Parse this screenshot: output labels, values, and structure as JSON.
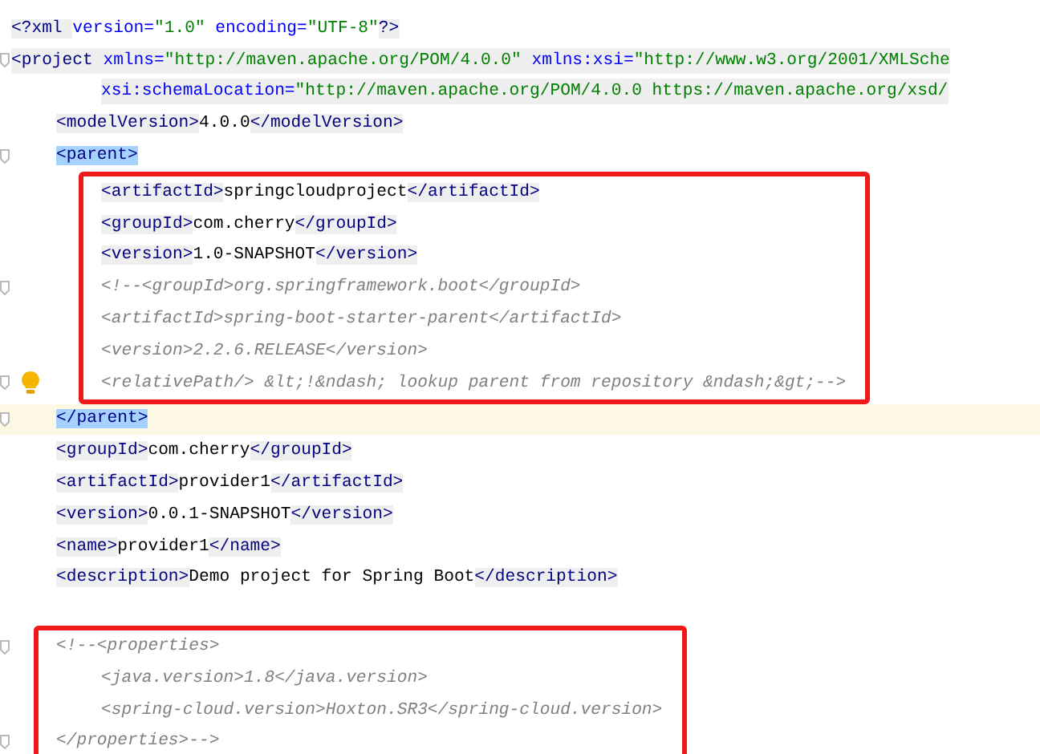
{
  "editor": {
    "items": [
      {
        "kind": "line",
        "current": false,
        "shaded": false,
        "fold_marker": false,
        "segments": [
          {
            "kind": "tag",
            "text": "<?xml "
          },
          {
            "kind": "attr",
            "text": "version="
          },
          {
            "kind": "value",
            "text": "\"1.0\""
          },
          {
            "kind": "attr",
            "text": " encoding="
          },
          {
            "kind": "value",
            "text": "\"UTF-8\""
          },
          {
            "kind": "tag",
            "text": "?>"
          }
        ]
      },
      {
        "kind": "line",
        "current": false,
        "shaded": true,
        "fold_marker": true,
        "segments": [
          {
            "kind": "tag",
            "text": "<project "
          },
          {
            "kind": "attr",
            "text": "xmlns="
          },
          {
            "kind": "value",
            "text": "\"http://maven.apache.org/POM/4.0.0\""
          },
          {
            "kind": "attr",
            "text": " xmlns:xsi="
          },
          {
            "kind": "value",
            "text": "\"http://www.w3.org/2001/XMLSche"
          }
        ],
        "children": [
          {
            "kind": "continuation",
            "current": false,
            "shaded": true,
            "fold_marker": false,
            "segments": [
              {
                "kind": "attr",
                "text": "xsi:schemaLocation="
              },
              {
                "kind": "value",
                "text": "\"http://maven.apache.org/POM/4.0.0 https://maven.apache.org/xsd/"
              }
            ]
          },
          {
            "kind": "line",
            "current": false,
            "shaded": false,
            "fold_marker": false,
            "segments": [
              {
                "kind": "tag",
                "text": "<modelVersion>"
              },
              {
                "kind": "text",
                "text": "4.0.0"
              },
              {
                "kind": "tag",
                "text": "</modelVersion>"
              }
            ]
          },
          {
            "kind": "line",
            "current": false,
            "shaded": false,
            "fold_marker": true,
            "segments": [
              {
                "kind": "tag",
                "text": "<parent>",
                "highlighted": true
              }
            ],
            "children": [
              {
                "kind": "box",
                "lines": [
                  {
                    "kind": "line",
                    "current": false,
                    "shaded": false,
                    "fold_marker": false,
                    "segments": [
                      {
                        "kind": "tag",
                        "text": "<artifactId>"
                      },
                      {
                        "kind": "text",
                        "text": "springcloudproject"
                      },
                      {
                        "kind": "tag",
                        "text": "</artifactId>"
                      }
                    ]
                  },
                  {
                    "kind": "line",
                    "current": false,
                    "shaded": false,
                    "fold_marker": false,
                    "segments": [
                      {
                        "kind": "tag",
                        "text": "<groupId>"
                      },
                      {
                        "kind": "text",
                        "text": "com.cherry"
                      },
                      {
                        "kind": "tag",
                        "text": "</groupId>"
                      }
                    ]
                  },
                  {
                    "kind": "line",
                    "current": false,
                    "shaded": false,
                    "fold_marker": false,
                    "segments": [
                      {
                        "kind": "tag",
                        "text": "<version>"
                      },
                      {
                        "kind": "text",
                        "text": "1.0-SNAPSHOT"
                      },
                      {
                        "kind": "tag",
                        "text": "</version>"
                      }
                    ]
                  },
                  {
                    "kind": "line",
                    "current": false,
                    "shaded": false,
                    "fold_marker": true,
                    "segments": [
                      {
                        "kind": "comment",
                        "text": "<!--<groupId>org.springframework.boot</groupId>"
                      }
                    ]
                  },
                  {
                    "kind": "line",
                    "current": false,
                    "shaded": false,
                    "fold_marker": false,
                    "segments": [
                      {
                        "kind": "comment",
                        "text": "<artifactId>spring-boot-starter-parent</artifactId>"
                      }
                    ]
                  },
                  {
                    "kind": "line",
                    "current": false,
                    "shaded": false,
                    "fold_marker": false,
                    "segments": [
                      {
                        "kind": "comment",
                        "text": "<version>2.2.6.RELEASE</version>"
                      }
                    ]
                  },
                  {
                    "kind": "line",
                    "current": false,
                    "shaded": false,
                    "fold_marker": true,
                    "lightbulb": true,
                    "segments": [
                      {
                        "kind": "comment",
                        "text": "<relativePath/> &lt;!&ndash; lookup parent from repository &ndash;&gt;-->"
                      }
                    ]
                  }
                ]
              }
            ]
          },
          {
            "kind": "line",
            "current": true,
            "shaded": false,
            "fold_marker": true,
            "segments": [
              {
                "kind": "tag",
                "text": "</parent>",
                "highlighted": true
              }
            ]
          },
          {
            "kind": "line",
            "current": false,
            "shaded": false,
            "fold_marker": false,
            "segments": [
              {
                "kind": "tag",
                "text": "<groupId>"
              },
              {
                "kind": "text",
                "text": "com.cherry"
              },
              {
                "kind": "tag",
                "text": "</groupId>"
              }
            ]
          },
          {
            "kind": "line",
            "current": false,
            "shaded": false,
            "fold_marker": false,
            "segments": [
              {
                "kind": "tag",
                "text": "<artifactId>"
              },
              {
                "kind": "text",
                "text": "provider1"
              },
              {
                "kind": "tag",
                "text": "</artifactId>"
              }
            ]
          },
          {
            "kind": "line",
            "current": false,
            "shaded": false,
            "fold_marker": false,
            "segments": [
              {
                "kind": "tag",
                "text": "<version>"
              },
              {
                "kind": "text",
                "text": "0.0.1-SNAPSHOT"
              },
              {
                "kind": "tag",
                "text": "</version>"
              }
            ]
          },
          {
            "kind": "line",
            "current": false,
            "shaded": false,
            "fold_marker": false,
            "segments": [
              {
                "kind": "tag",
                "text": "<name>"
              },
              {
                "kind": "text",
                "text": "provider1"
              },
              {
                "kind": "tag",
                "text": "</name>"
              }
            ]
          },
          {
            "kind": "line",
            "current": false,
            "shaded": false,
            "fold_marker": false,
            "segments": [
              {
                "kind": "tag",
                "text": "<description>"
              },
              {
                "kind": "text",
                "text": "Demo project for Spring Boot"
              },
              {
                "kind": "tag",
                "text": "</description>"
              }
            ]
          },
          {
            "kind": "blank"
          },
          {
            "kind": "box",
            "lines": [
              {
                "kind": "line",
                "current": false,
                "shaded": false,
                "fold_marker": true,
                "segments": [
                  {
                    "kind": "comment",
                    "text": "<!--<properties>"
                  }
                ],
                "children": [
                  {
                    "kind": "line",
                    "current": false,
                    "shaded": false,
                    "fold_marker": false,
                    "segments": [
                      {
                        "kind": "comment",
                        "text": "<java.version>1.8</java.version>"
                      }
                    ]
                  },
                  {
                    "kind": "line",
                    "current": false,
                    "shaded": false,
                    "fold_marker": false,
                    "segments": [
                      {
                        "kind": "comment",
                        "text": "<spring-cloud.version>Hoxton.SR3</spring-cloud.version>"
                      }
                    ]
                  }
                ]
              },
              {
                "kind": "line",
                "current": false,
                "shaded": false,
                "fold_marker": true,
                "segments": [
                  {
                    "kind": "comment",
                    "text": "</properties>-->"
                  }
                ]
              }
            ]
          }
        ]
      }
    ]
  }
}
